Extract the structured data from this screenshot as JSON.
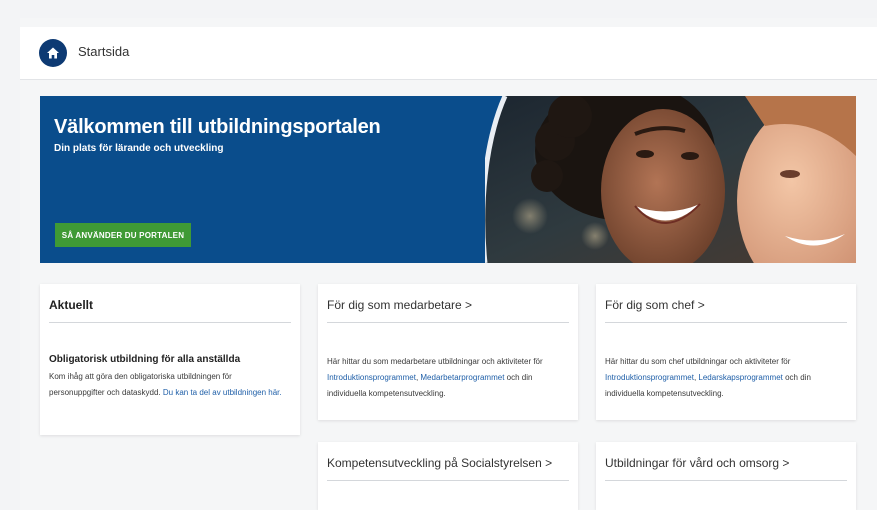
{
  "header": {
    "home_icon": "home-icon",
    "title": "Startsida"
  },
  "hero": {
    "title": "Välkommen till utbildningsportalen",
    "subtitle": "Din plats för lärande och utveckling",
    "button_label": "SÅ ANVÄNDER DU PORTALEN",
    "background_color": "#0a4d8c",
    "button_color": "#3f9a35"
  },
  "cards": {
    "news": {
      "title": "Aktuellt",
      "item_heading": "Obligatorisk utbildning för alla anställda",
      "item_text": "Kom ihåg att göra den obligatoriska utbildningen för personuppgifter och dataskydd.",
      "item_link": "Du kan ta del av utbildningen här."
    },
    "employee": {
      "title": "För dig som medarbetare >",
      "text_before": "Här hittar du som medarbetare utbildningar och aktiviteter för",
      "link1": "Introduktionsprogrammet",
      "separator": ", ",
      "link2": "Medarbetarprogrammet",
      "text_after": "och din individuella kompetensutveckling."
    },
    "manager": {
      "title": "För dig som chef >",
      "text_before": "Här hittar du som chef utbildningar och aktiviteter för",
      "link1": "Introduktionsprogrammet",
      "separator": ", ",
      "link2": "Ledarskapsprogrammet",
      "text_after": "och din individuella kompetensutveckling."
    },
    "competence": {
      "title": "Kompetensutveckling på Socialstyrelsen >"
    },
    "care": {
      "title": "Utbildningar för vård och omsorg >"
    }
  },
  "colors": {
    "link": "#1f5fa8",
    "navy": "#0d3a73"
  }
}
